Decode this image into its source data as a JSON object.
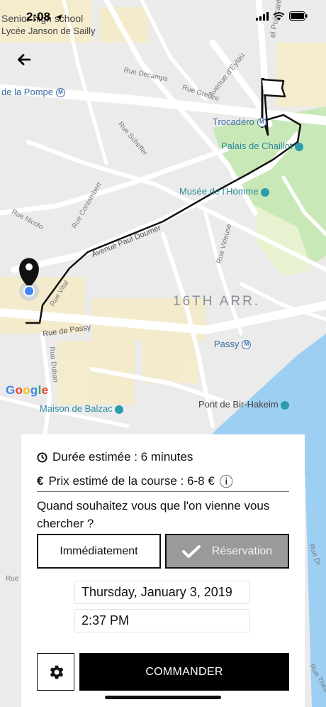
{
  "status_bar": {
    "time": "2:08"
  },
  "map": {
    "streets": {
      "rue_decamps": "Rue Decamps",
      "avenue_eylau": "Avenue d'Eylau",
      "rue_greuze": "Rue Greuze",
      "rue_scheffer": "Rue Scheffer",
      "rue_contambert": "Rue Contambert",
      "rue_nicolo": "Rue Nicolo",
      "avenue_paul_doumer": "Avenue Paul Doumer",
      "rue_vital": "Rue Vital",
      "rue_vineuse": "Rue Vineuse",
      "rue_de_passy": "Rue de Passy",
      "rue_duban": "Rue Duban",
      "rue_fragment": "Rue",
      "rue_poincare": "el Poincaré",
      "rue_dr": "Rue Dr",
      "rue_theatre": "Rue Théâ"
    },
    "pois": {
      "senior_high_school": "Senior high school",
      "lycee": "Lycée Janson de Sailly",
      "de_la_pompe": "de la Pompe",
      "trocadero": "Trocadéro",
      "palais_chaillot": "Palais de Chaillot",
      "musee_homme": "Musée de l'Homme",
      "passy": "Passy",
      "pont_bir_hakeim": "Pont de Bir-Hakeim",
      "maison_balzac": "Maison de Balzac"
    },
    "district": "16TH ARR.",
    "metro_symbol": "M",
    "google_logo": [
      "G",
      "o",
      "o",
      "g",
      "l",
      "e"
    ],
    "colors": {
      "route": "#111111",
      "origin_dot": "#4285f4",
      "park": "#c9e8b8",
      "water": "#9dcff2",
      "road": "#ffffff",
      "block": "#f6edcf"
    }
  },
  "panel": {
    "duration": "Durée estimée : 6 minutes",
    "price": "Prix estimé de la course : 6-8 €",
    "euro_symbol": "€",
    "info_icon": "ⓘ",
    "question": "Quand souhaitez vous que l'on vienne vous chercher ?",
    "buttons": {
      "immediate": "Immédiatement",
      "reservation": "Réservation",
      "order": "COMMANDER"
    },
    "selected_mode": "reservation",
    "date": "Thursday, January 3, 2019",
    "time": "2:37 PM"
  }
}
